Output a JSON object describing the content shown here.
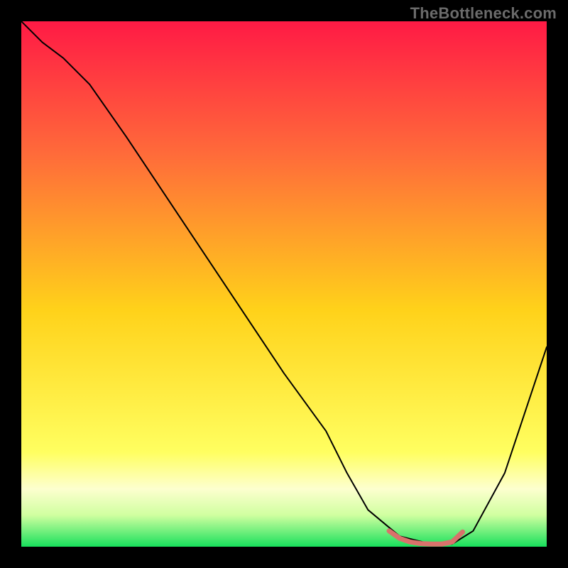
{
  "watermark": "TheBottleneck.com",
  "chart_data": {
    "type": "line",
    "title": "",
    "xlabel": "",
    "ylabel": "",
    "x_range": [
      0,
      100
    ],
    "y_range": [
      0,
      100
    ],
    "series": [
      {
        "name": "bottleneck-curve",
        "color": "#000000",
        "x": [
          0,
          4,
          8,
          13,
          20,
          30,
          40,
          50,
          58,
          62,
          66,
          72,
          78,
          82,
          86,
          92,
          100
        ],
        "y": [
          100,
          96,
          93,
          88,
          78,
          63,
          48,
          33,
          22,
          14,
          7,
          2,
          0.5,
          0.5,
          3,
          14,
          38
        ]
      }
    ],
    "highlight": {
      "name": "optimal-band",
      "color": "#d9726b",
      "x": [
        70,
        72,
        74,
        76,
        78,
        80,
        82,
        84
      ],
      "y": [
        3,
        1.6,
        0.9,
        0.6,
        0.5,
        0.5,
        0.9,
        2.8
      ]
    },
    "gradient_stops": [
      {
        "offset": 0.0,
        "color": "#ff1a45"
      },
      {
        "offset": 0.25,
        "color": "#ff6a3a"
      },
      {
        "offset": 0.55,
        "color": "#ffd21a"
      },
      {
        "offset": 0.82,
        "color": "#ffff60"
      },
      {
        "offset": 0.89,
        "color": "#fdffcf"
      },
      {
        "offset": 0.94,
        "color": "#d0ffa0"
      },
      {
        "offset": 1.0,
        "color": "#18e05c"
      }
    ]
  }
}
